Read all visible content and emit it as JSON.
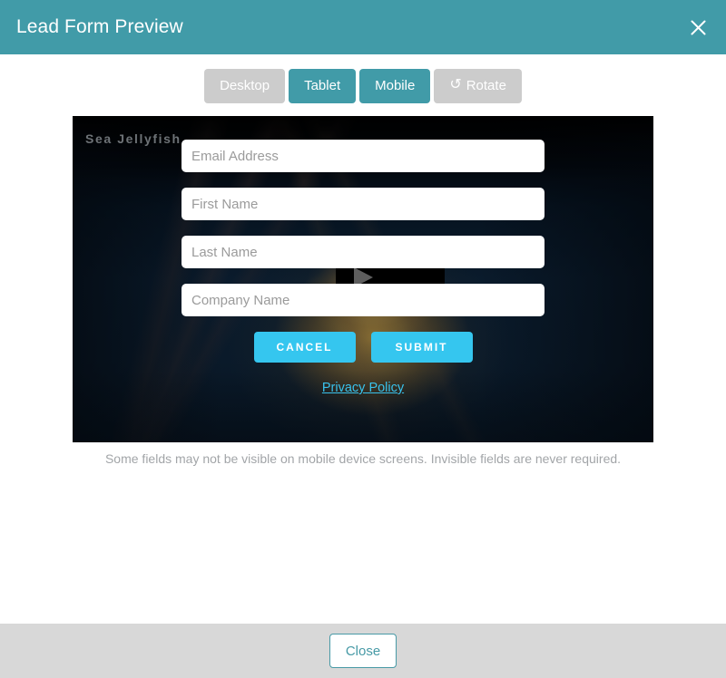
{
  "header": {
    "title": "Lead Form Preview",
    "close_icon": "close-x-icon",
    "background_color": "#419ba8"
  },
  "device_toolbar": {
    "buttons": [
      {
        "label": "Desktop",
        "state": "disabled",
        "color": "#cccccc"
      },
      {
        "label": "Tablet",
        "state": "active",
        "color": "#419ba8"
      },
      {
        "label": "Mobile",
        "state": "active",
        "color": "#419ba8"
      },
      {
        "label": "Rotate",
        "state": "disabled",
        "color": "#cccccc",
        "icon": "rotate-ccw-icon",
        "icon_glyph": "↺"
      }
    ]
  },
  "preview": {
    "form_title": "Sea Jellyfish",
    "media": {
      "type": "video-poster",
      "play_icon": "play-triangle-icon",
      "description": "underwater jellyfish photograph"
    },
    "fields": [
      {
        "name": "email",
        "placeholder": "Email Address",
        "value": ""
      },
      {
        "name": "first-name",
        "placeholder": "First Name",
        "value": ""
      },
      {
        "name": "last-name",
        "placeholder": "Last Name",
        "value": ""
      },
      {
        "name": "company-name",
        "placeholder": "Company Name",
        "value": ""
      }
    ],
    "cancel_label": "CANCEL",
    "submit_label": "SUBMIT",
    "privacy_label": "Privacy Policy",
    "button_color": "#35c6ef",
    "link_color": "#39c2ec"
  },
  "helper_note": "Some fields may not be visible on mobile device screens. Invisible fields are never required.",
  "footer": {
    "close_label": "Close",
    "background_color": "#d8d8d8",
    "button_border_color": "#489aa6"
  }
}
